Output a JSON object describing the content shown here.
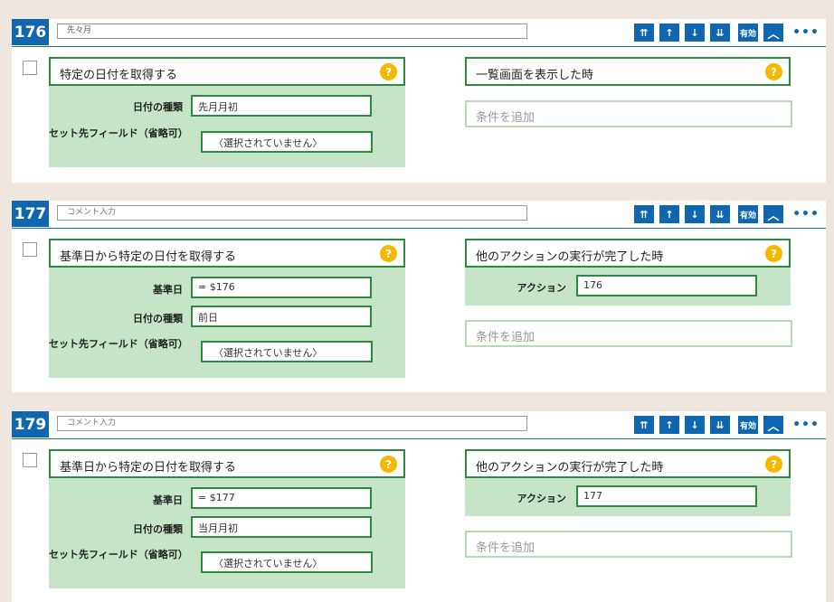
{
  "toolbar": {
    "up_top": "⇈",
    "up": "↑",
    "down": "↓",
    "down_bottom": "⇊",
    "enabled": "有効",
    "collapse": "︿",
    "more": "•••"
  },
  "help_glyph": "?",
  "condition_placeholder": "条件を追加",
  "blocks": [
    {
      "number": "176",
      "comment": "先々月",
      "action_title": "特定の日付を取得する",
      "fields": [
        {
          "label": "日付の種類",
          "value": "先月月初"
        },
        {
          "label": "セット先フィールド（省略可）",
          "value": "〈選択されていません〉"
        }
      ],
      "trigger_title": "一覧画面を表示した時"
    },
    {
      "number": "177",
      "comment": "コメント入力",
      "action_title": "基準日から特定の日付を取得する",
      "fields": [
        {
          "label": "基準日",
          "value": "= $176"
        },
        {
          "label": "日付の種類",
          "value": "前日"
        },
        {
          "label": "セット先フィールド（省略可）",
          "value": "〈選択されていません〉"
        }
      ],
      "trigger_title": "他のアクションの実行が完了した時",
      "trigger_field": {
        "label": "アクション",
        "value": "176"
      }
    },
    {
      "number": "179",
      "comment": "コメント入力",
      "action_title": "基準日から特定の日付を取得する",
      "fields": [
        {
          "label": "基準日",
          "value": "= $177"
        },
        {
          "label": "日付の種類",
          "value": "当月月初"
        },
        {
          "label": "セット先フィールド（省略可）",
          "value": "〈選択されていません〉"
        }
      ],
      "trigger_title": "他のアクションの実行が完了した時",
      "trigger_field": {
        "label": "アクション",
        "value": "177"
      }
    }
  ]
}
